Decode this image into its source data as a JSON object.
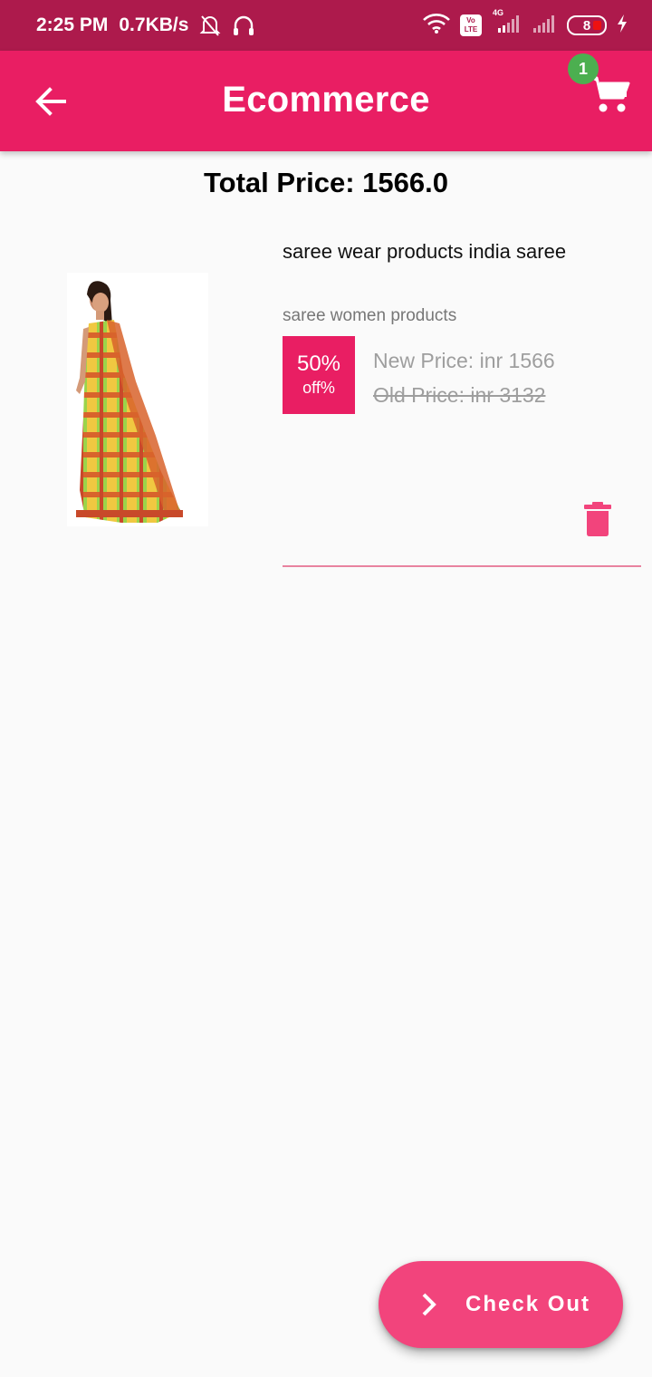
{
  "status_bar": {
    "time": "2:25 PM",
    "speed": "0.7KB/s",
    "network": "4G",
    "volte": "Vo LTE",
    "battery": "8",
    "icons": [
      "mute-bell-icon",
      "headphones-icon",
      "wifi-icon",
      "signal-icon",
      "battery-icon",
      "charging-icon"
    ]
  },
  "app_bar": {
    "title": "Ecommerce",
    "back_icon": "arrow-back-icon",
    "cart_icon": "shopping-cart-icon",
    "cart_count": "1"
  },
  "total_price": "Total Price: 1566.0",
  "cart_items": [
    {
      "title": "saree wear products india saree",
      "subtitle": "saree women products",
      "discount_percent": "50%",
      "discount_suffix": "off%",
      "new_price": "New Price: inr 1566",
      "old_price": "Old Price: inr 3132",
      "delete_icon": "trash-icon"
    }
  ],
  "checkout": {
    "label": "Check Out",
    "icon": "chevron-right-icon"
  },
  "colors": {
    "primary": "#e91e63",
    "status_bar": "#ad1a4c",
    "badge_green": "#4caf50",
    "fab": "#f2447c"
  }
}
